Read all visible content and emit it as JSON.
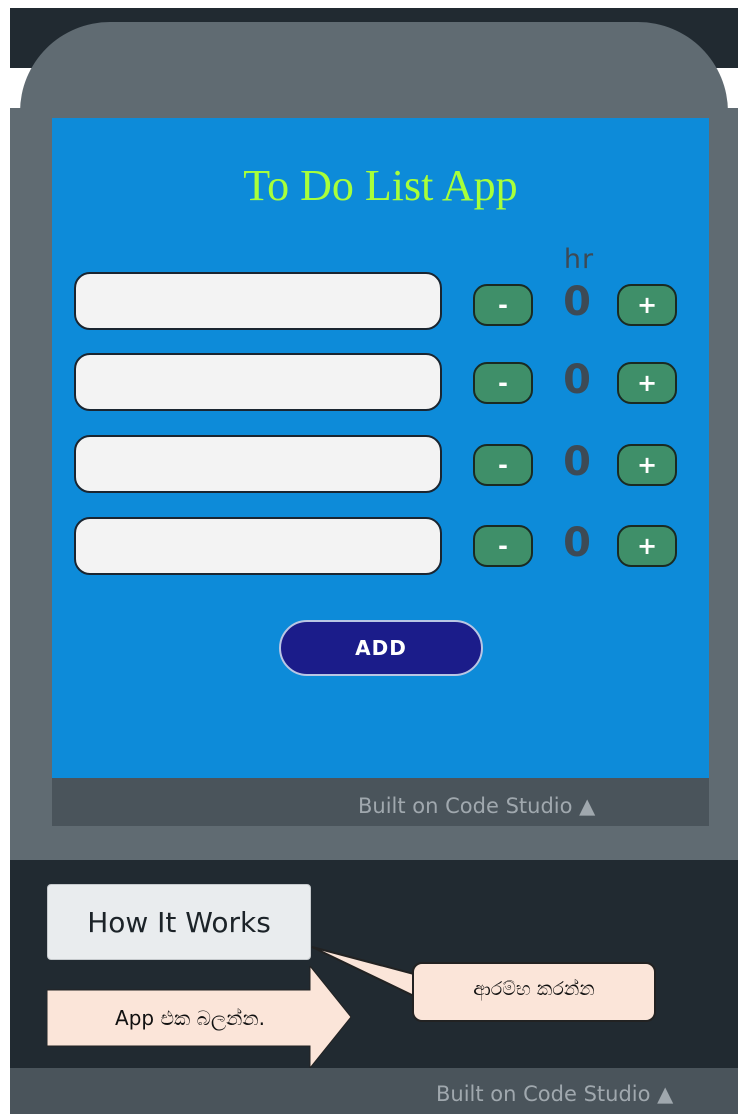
{
  "app": {
    "title": "To Do List App",
    "hr_label": "hr",
    "tasks": [
      {
        "value": "",
        "hours": "0",
        "minus_label": "-",
        "plus_label": "+"
      },
      {
        "value": "",
        "hours": "0",
        "minus_label": "-",
        "plus_label": "+"
      },
      {
        "value": "",
        "hours": "0",
        "minus_label": "-",
        "plus_label": "+"
      },
      {
        "value": "",
        "hours": "0",
        "minus_label": "-",
        "plus_label": "+"
      }
    ],
    "add_label": "ADD",
    "built_on": "Built on Code Studio ▲"
  },
  "tutorial": {
    "how_it_works_label": "How It Works",
    "arrow_note": "App එක බලන්න.",
    "speech_note": "ආරම්භ කරන්න"
  },
  "footer": {
    "built_on": "Built on Code Studio ▲"
  },
  "colors": {
    "screen_bg": "#0d8bd9",
    "title": "#a8ff3a",
    "step_button": "#3f8f69",
    "add_button": "#1b1c8a",
    "callout_fill": "#fbe5d9"
  }
}
